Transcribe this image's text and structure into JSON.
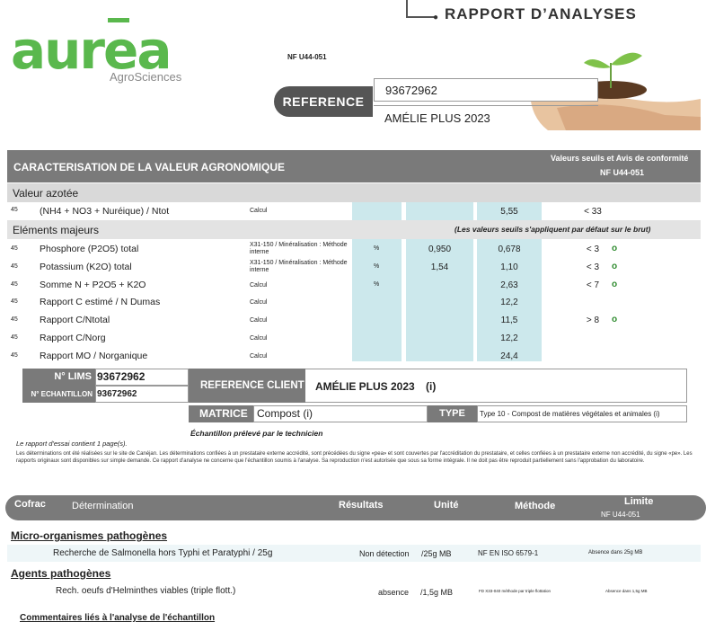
{
  "header": {
    "report_title": "RAPPORT D’ANALYSES",
    "logo_text": "aurea",
    "logo_sub": "AgroSciences",
    "norm": "NF U44-051",
    "reference_label": "REFERENCE",
    "reference_value": "93672962",
    "reference_product": "AMÉLIE PLUS 2023"
  },
  "characterisation": {
    "title": "CARACTERISATION DE LA VALEUR AGRONOMIQUE",
    "right_title": "Valeurs seuils et Avis de conformité",
    "right_norm": "NF U44-051",
    "section_nitrogen": "Valeur azotée",
    "section_major": "Eléments majeurs",
    "major_note": "(Les valeurs seuils s'appliquent par défaut sur le brut)",
    "rows": [
      {
        "code": "45",
        "label": "(NH4 + NO3 + Nuréique) / Ntot",
        "method": "Calcul",
        "unit": "",
        "v1": "",
        "v2": "5,55",
        "limit": "< 33",
        "ok": "o"
      },
      {
        "code": "45",
        "label": "Phosphore (P2O5) total",
        "method": "X31-150 / Minéralisation : Méthode interne",
        "unit": "%",
        "v1": "0,950",
        "v2": "0,678",
        "limit": "< 3",
        "ok": "o"
      },
      {
        "code": "45",
        "label": "Potassium (K2O) total",
        "method": "X31-150 / Minéralisation : Méthode interne",
        "unit": "%",
        "v1": "1,54",
        "v2": "1,10",
        "limit": "< 3",
        "ok": "o"
      },
      {
        "code": "45",
        "label": "Somme N + P2O5 + K2O",
        "method": "Calcul",
        "unit": "%",
        "v1": "",
        "v2": "2,63",
        "limit": "< 7",
        "ok": "o"
      },
      {
        "code": "45",
        "label": "Rapport C estimé / N Dumas",
        "method": "Calcul",
        "unit": "",
        "v1": "",
        "v2": "12,2",
        "limit": "",
        "ok": ""
      },
      {
        "code": "45",
        "label": "Rapport C/Ntotal",
        "method": "Calcul",
        "unit": "",
        "v1": "",
        "v2": "11,5",
        "limit": "> 8",
        "ok": "o"
      },
      {
        "code": "45",
        "label": "Rapport C/Norg",
        "method": "Calcul",
        "unit": "",
        "v1": "",
        "v2": "12,2",
        "limit": "",
        "ok": ""
      },
      {
        "code": "45",
        "label": "Rapport MO / Norganique",
        "method": "Calcul",
        "unit": "",
        "v1": "",
        "v2": "24,4",
        "limit": "",
        "ok": ""
      }
    ]
  },
  "sample": {
    "lims_label": "N° LIMS",
    "lims_value": "93672962",
    "echantillon_label": "N° ECHANTILLON",
    "echantillon_value": "93672962",
    "ref_client_label": "REFERENCE CLIENT",
    "ref_client_value": "AMÉLIE PLUS 2023",
    "ref_client_suffix": "(i)",
    "matrice_label": "MATRICE",
    "matrice_value": "Compost (i)",
    "type_label": "TYPE",
    "type_value": "Type 10 - Compost de matières végétales et animales (i)",
    "prelevement": "Échantillon prélevé par le technicien"
  },
  "notes": {
    "pages": "Le rapport d'essai contient 1 page(s).",
    "legal": "Les déterminations ont été réalisées sur le site de Canéjan. Les déterminations confiées à un prestataire externe accrédité, sont précédées du signe «pea» et sont couvertes par l'accréditation du prestataire, et celles confiées à un prestataire externe non accrédité, du signe «pe». Les rapports originaux sont disponibles sur simple demande. Ce rapport d'analyse ne concerne que l'échantillon soumis à l'analyse. Sa reproduction n'est autorisée que sous sa forme intégrale. Il ne doit pas être reproduit partiellement sans l'approbation du laboratoire."
  },
  "table": {
    "cols": {
      "cofrac": "Cofrac",
      "determination": "Détermination",
      "resultats": "Résultats",
      "unite": "Unité",
      "methode": "Méthode",
      "limite": "Limite",
      "limite_norm": "NF U44-051"
    },
    "section1": "Micro-organismes pathogènes",
    "row1": {
      "label": "Recherche de Salmonella hors Typhi et Paratyphi / 25g",
      "result": "Non détection",
      "unit": "/25g MB",
      "method": "NF EN ISO 6579-1",
      "limit": "Absence dans 25g MB"
    },
    "section2": "Agents pathogènes",
    "row2": {
      "label": "Rech. oeufs d'Helminthes viables (triple flott.)",
      "result": "absence",
      "unit": "/1,5g MB",
      "method": "FD X33-040 méthode par triple flottation",
      "limit": "Absence dans 1,5g MB"
    },
    "comments": "Commentaires liés à l'analyse de l'échantillon"
  },
  "colors": {
    "accent": "#5ab84d",
    "band": "#7a7a7a",
    "shade": "#cce8ec"
  }
}
